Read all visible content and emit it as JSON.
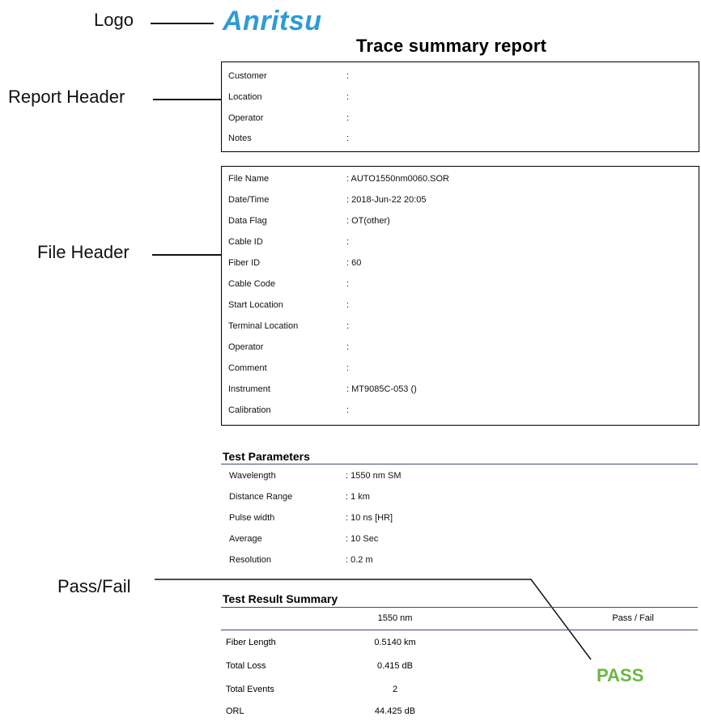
{
  "brand": {
    "name": "Anritsu",
    "color": "#2e9bd6"
  },
  "callouts": {
    "logo": "Logo",
    "report_header": "Report Header",
    "file_header": "File Header",
    "pass_fail": "Pass/Fail"
  },
  "report": {
    "title": "Trace summary report"
  },
  "report_header": {
    "rows": [
      {
        "label": "Customer",
        "value": ":"
      },
      {
        "label": "Location",
        "value": ":"
      },
      {
        "label": "Operator",
        "value": ":"
      },
      {
        "label": "Notes",
        "value": ":"
      }
    ]
  },
  "file_header": {
    "rows": [
      {
        "label": "File Name",
        "value": ": AUTO1550nm0060.SOR"
      },
      {
        "label": "Date/Time",
        "value": ": 2018-Jun-22 20:05"
      },
      {
        "label": "Data Flag",
        "value": ": OT(other)"
      },
      {
        "label": "Cable ID",
        "value": ":"
      },
      {
        "label": "Fiber ID",
        "value": ": 60"
      },
      {
        "label": "Cable Code",
        "value": ":"
      },
      {
        "label": "Start Location",
        "value": ":"
      },
      {
        "label": "Terminal Location",
        "value": ":"
      },
      {
        "label": "Operator",
        "value": ":"
      },
      {
        "label": "Comment",
        "value": ":"
      },
      {
        "label": "Instrument",
        "value": ": MT9085C-053 ()"
      },
      {
        "label": "Calibration",
        "value": ":"
      }
    ]
  },
  "test_parameters": {
    "title": "Test Parameters",
    "rows": [
      {
        "label": "Wavelength",
        "value": ": 1550 nm SM"
      },
      {
        "label": "Distance Range",
        "value": ": 1 km"
      },
      {
        "label": "Pulse width",
        "value": ": 10 ns [HR]"
      },
      {
        "label": "Average",
        "value": ": 10 Sec"
      },
      {
        "label": "Resolution",
        "value": ": 0.2 m"
      }
    ]
  },
  "test_result_summary": {
    "title": "Test Result Summary",
    "columns": [
      "",
      "1550 nm",
      "Pass / Fail"
    ],
    "rows": [
      {
        "label": "Fiber Length",
        "value": "0.5140 km"
      },
      {
        "label": "Total Loss",
        "value": "0.415 dB"
      },
      {
        "label": "Total Events",
        "value": "2"
      },
      {
        "label": "ORL",
        "value": "44.425 dB"
      }
    ],
    "result": "PASS",
    "result_color": "#6ab741"
  }
}
